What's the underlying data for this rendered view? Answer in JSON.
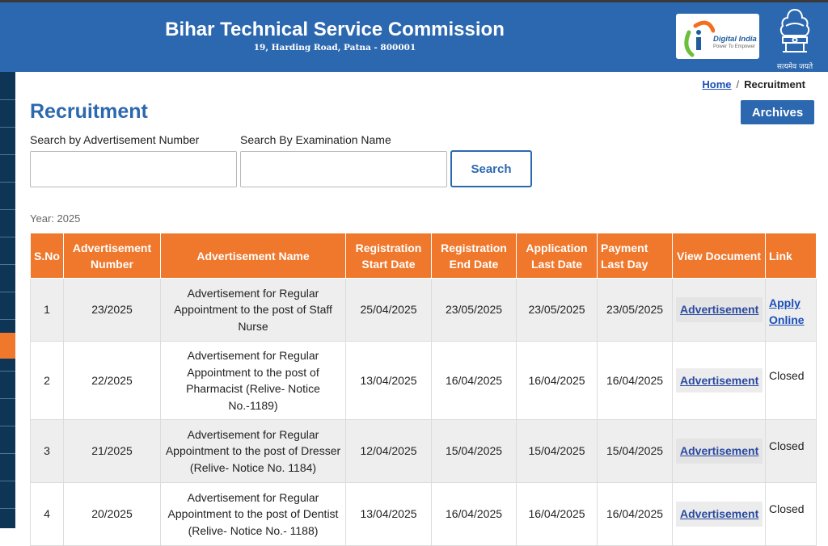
{
  "header": {
    "title": "Bihar Technical Service Commission",
    "address": "19, Harding Road, Patna - 800001",
    "digital_india": {
      "title": "Digital India",
      "tagline": "Power To Empower"
    },
    "emblem_motto": "सत्यमेव जयते"
  },
  "breadcrumb": {
    "home": "Home",
    "separator": "/",
    "current": "Recruitment"
  },
  "page_title": "Recruitment",
  "archives_label": "Archives",
  "search": {
    "adv_label": "Search by Advertisement Number",
    "adv_value": "",
    "exam_label": "Search By Examination Name",
    "exam_value": "",
    "button_label": "Search"
  },
  "year_label": "Year: 2025",
  "table": {
    "headers": [
      "S.No",
      "Advertisement Number",
      "Advertisement Name",
      "Registration Start Date",
      "Registration End Date",
      "Application Last Date",
      "Payment Last Day",
      "View Document",
      "Link"
    ],
    "rows": [
      {
        "sno": "1",
        "adv_no": "23/2025",
        "name": "Advertisement for Regular Appointment to the post of Staff Nurse",
        "reg_start": "25/04/2025",
        "reg_end": "23/05/2025",
        "app_last": "23/05/2025",
        "pay_last": "23/05/2025",
        "doc": "Advertisement",
        "link": "Apply Online"
      },
      {
        "sno": "2",
        "adv_no": "22/2025",
        "name": "Advertisement for Regular Appointment to the post of Pharmacist (Relive- Notice No.-1189)",
        "reg_start": "13/04/2025",
        "reg_end": "16/04/2025",
        "app_last": "16/04/2025",
        "pay_last": "16/04/2025",
        "doc": "Advertisement",
        "link": "Closed"
      },
      {
        "sno": "3",
        "adv_no": "21/2025",
        "name": "Advertisement for Regular Appointment to the post of Dresser (Relive- Notice No. 1184)",
        "reg_start": "12/04/2025",
        "reg_end": "15/04/2025",
        "app_last": "15/04/2025",
        "pay_last": "15/04/2025",
        "doc": "Advertisement",
        "link": "Closed"
      },
      {
        "sno": "4",
        "adv_no": "20/2025",
        "name": "Advertisement for Regular Appointment to the post of Dentist (Relive- Notice No.- 1188)",
        "reg_start": "13/04/2025",
        "reg_end": "16/04/2025",
        "app_last": "16/04/2025",
        "pay_last": "16/04/2025",
        "doc": "Advertisement",
        "link": "Closed"
      }
    ]
  },
  "colors": {
    "brand_blue": "#2c68b0",
    "table_header_orange": "#f0782c",
    "sidebar_navy": "#0f3556"
  }
}
